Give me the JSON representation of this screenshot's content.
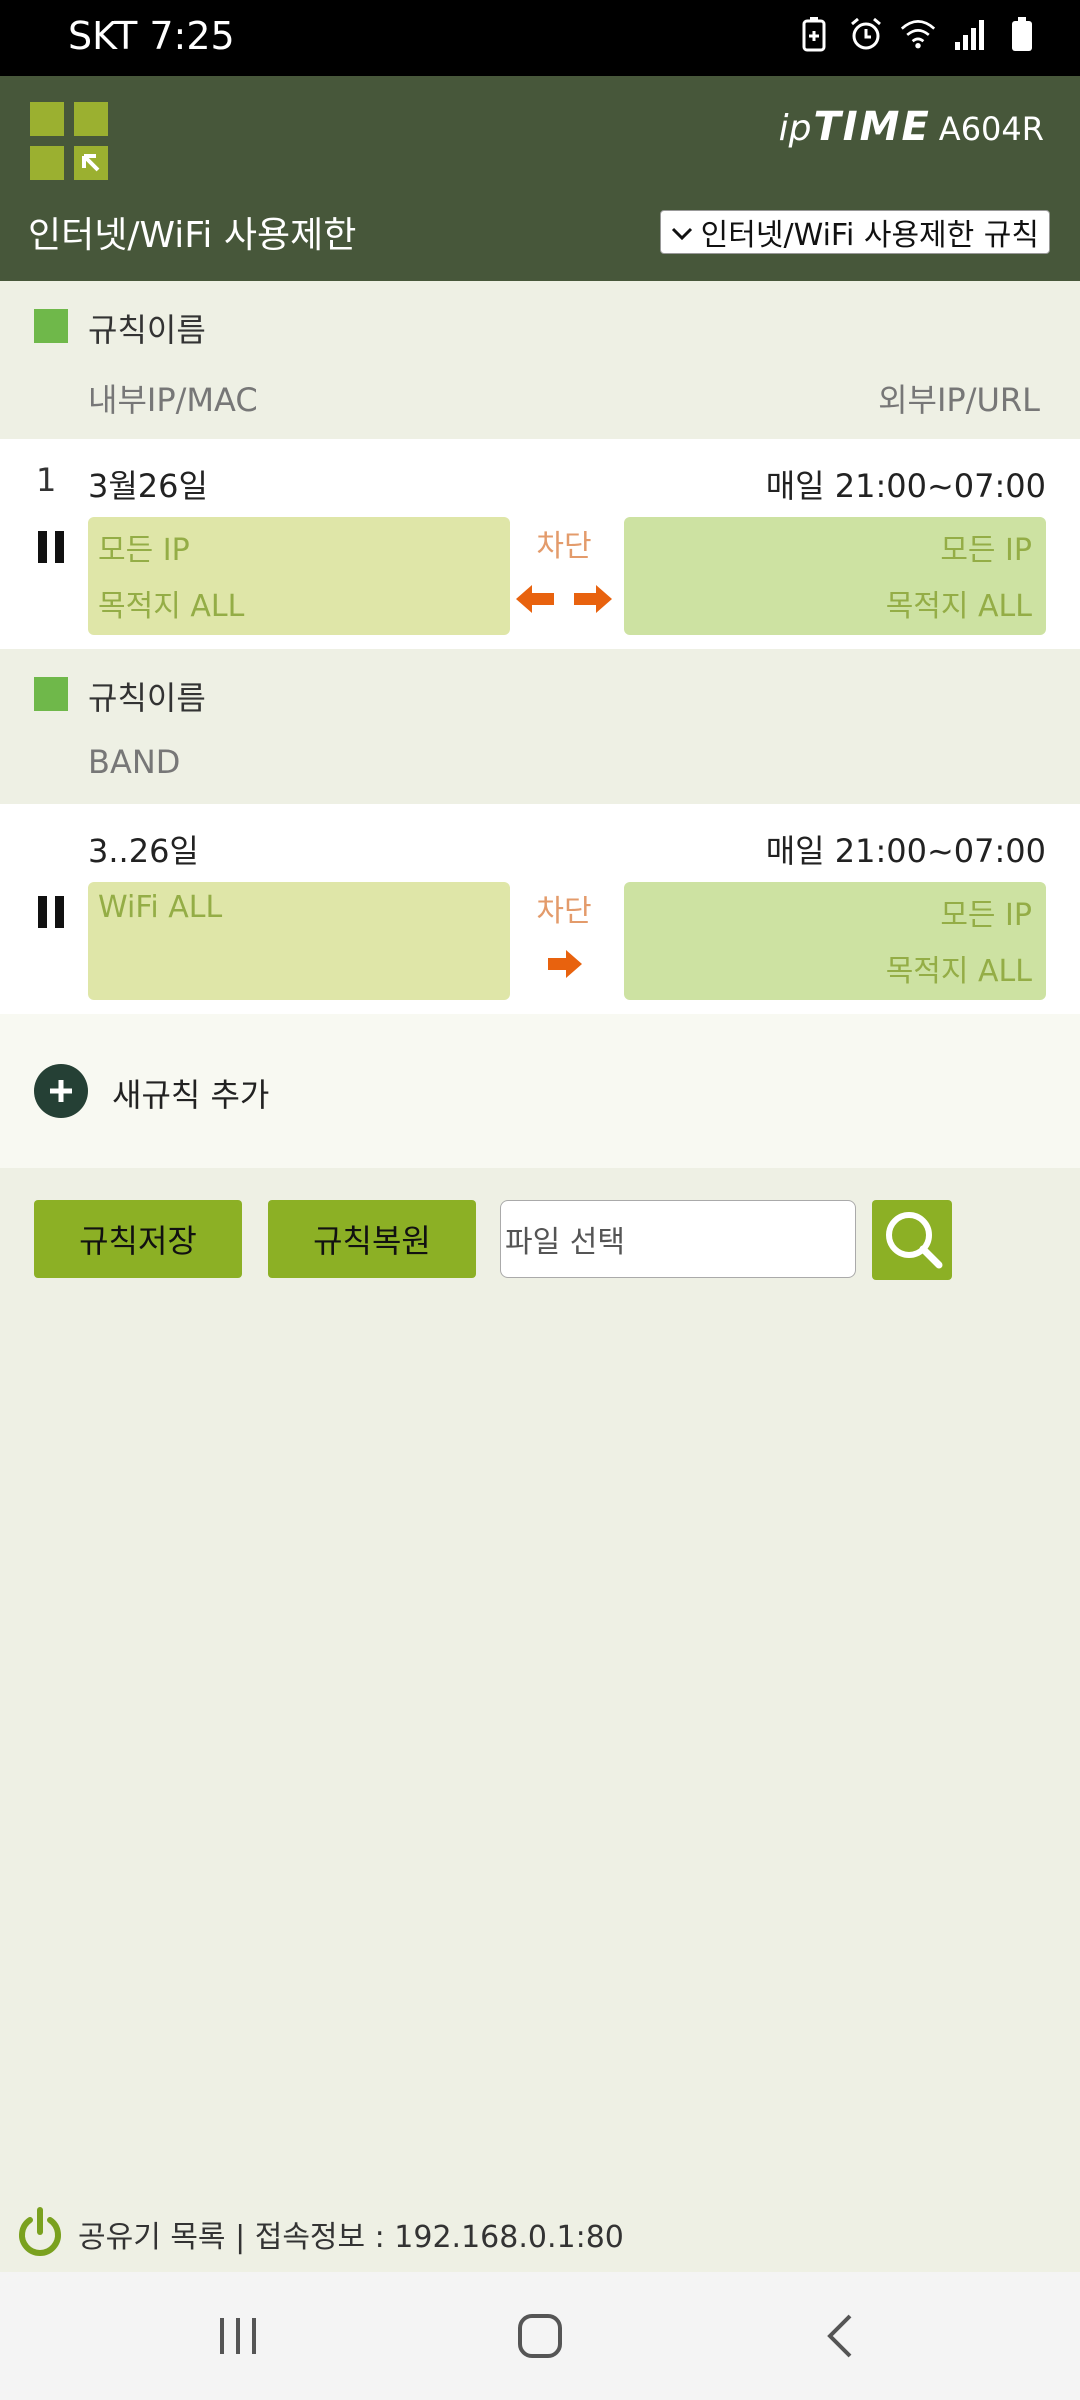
{
  "status_bar": {
    "carrier_time": "SKT 7:25"
  },
  "header": {
    "brand_prefix": "ip",
    "brand_name": "TIME",
    "model": "A604R",
    "title": "인터넷/WiFi 사용제한",
    "rule_select_value": "인터넷/WiFi 사용제한 규칙"
  },
  "legend": {
    "rule_name_label": "규칙이름",
    "internal_label": "내부IP/MAC",
    "external_label": "외부IP/URL"
  },
  "rules": [
    {
      "index": "1",
      "name": "3월26일",
      "schedule": "매일 21:00~07:00",
      "src_line1": "모든 IP",
      "src_line2": "목적지 ALL",
      "action": "차단",
      "dst_line1": "모든 IP",
      "dst_line2": "목적지 ALL"
    },
    {
      "index": "",
      "name": "3..26일",
      "schedule": "매일 21:00~07:00",
      "src_line1": "WiFi ALL",
      "src_line2": "",
      "action": "차단",
      "dst_line1": "모든 IP",
      "dst_line2": "목적지 ALL"
    }
  ],
  "legend2": {
    "rule_name_label": "규칙이름",
    "band_label": "BAND"
  },
  "add_rule": {
    "label": "새규칙 추가"
  },
  "toolbar": {
    "save_label": "규칙저장",
    "restore_label": "규칙복원",
    "file_placeholder": "파일 선택"
  },
  "footer": {
    "text": "공유기 목록 | 접속정보 : 192.168.0.1:80"
  },
  "colors": {
    "header_bg": "#47573a",
    "accent_green": "#8cb025",
    "arrow_orange": "#e8620e"
  },
  "icons": {
    "menu": "grid-menu-icon",
    "pause": "pause-icon",
    "arrows_both": "bidirectional-arrow-icon",
    "arrow_right": "right-arrow-icon",
    "add": "plus-circle-icon",
    "search": "search-icon",
    "power": "power-icon"
  }
}
